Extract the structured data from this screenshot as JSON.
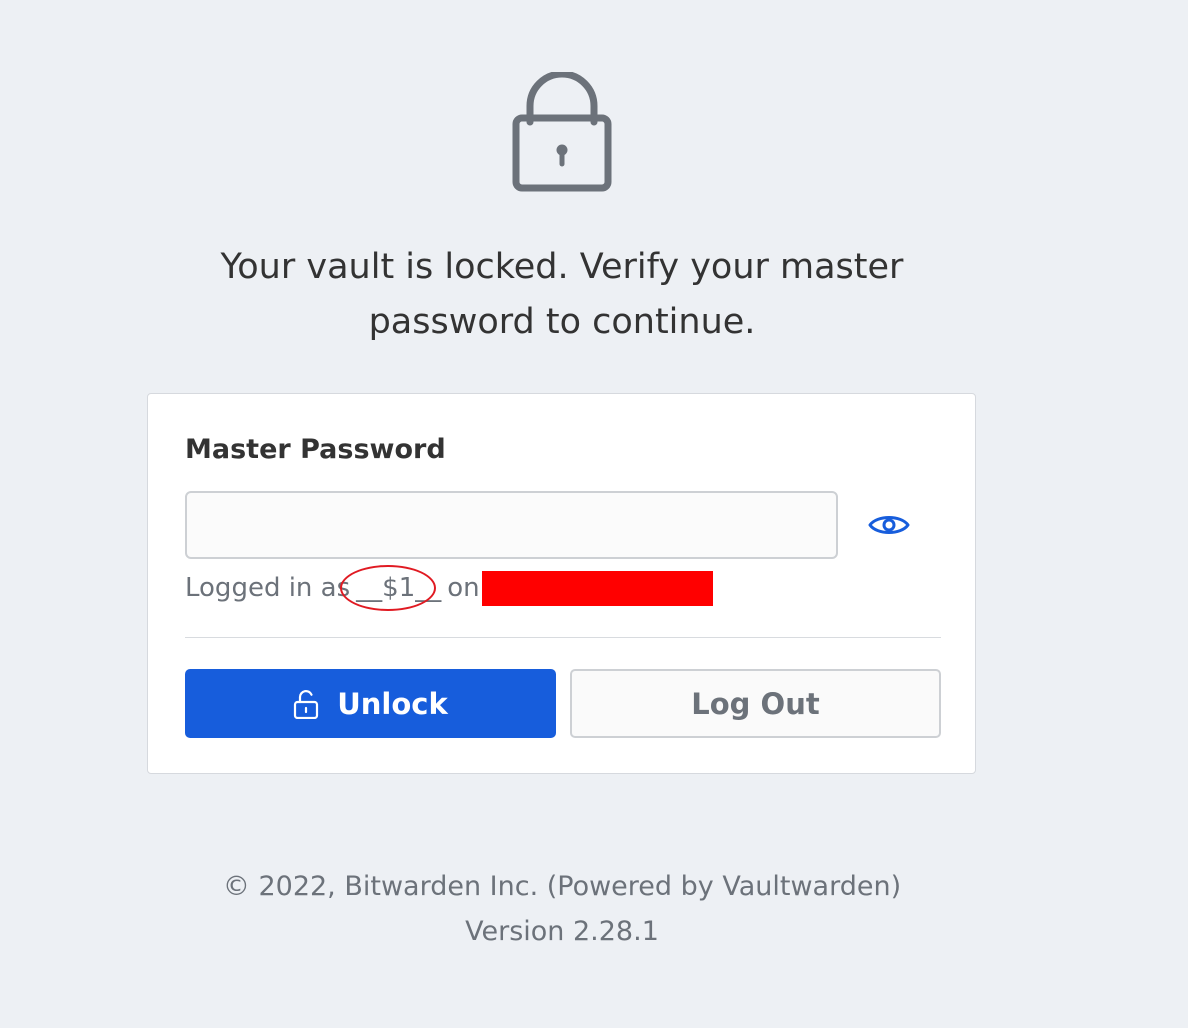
{
  "lock_screen": {
    "icon": "lock-icon",
    "message": "Your vault is locked. Verify your master password to continue."
  },
  "form": {
    "label": "Master Password",
    "input_value": "",
    "toggle_icon": "eye-icon",
    "logged_in_prefix": "Logged in as",
    "logged_in_user": "__$1__",
    "logged_in_on": "on",
    "divider": true
  },
  "buttons": {
    "unlock_label": "Unlock",
    "unlock_icon": "unlock-icon",
    "logout_label": "Log Out"
  },
  "colors": {
    "background": "#edf0f4",
    "primary": "#175ddc",
    "muted_text": "#6c727a",
    "redaction": "#ff0000",
    "annotation_circle": "#e01a22"
  },
  "footer": {
    "copyright": "© 2022, Bitwarden Inc. (Powered by Vaultwarden)",
    "version": "Version 2.28.1"
  }
}
